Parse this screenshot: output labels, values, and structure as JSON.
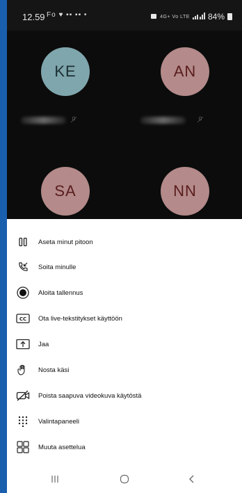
{
  "status_bar": {
    "time": "12.59",
    "left_icons": "Fo ♥ ▪▪ ▪▪ •",
    "network": "4G+ Vo LTE",
    "battery": "84%"
  },
  "participants": [
    {
      "initials": "KE",
      "bg": "#7fa6ad",
      "fg": "#1b2f33"
    },
    {
      "initials": "AN",
      "bg": "#b48a8a",
      "fg": "#5a1d1d"
    },
    {
      "initials": "SA",
      "bg": "#b48a8a",
      "fg": "#5a1d1d"
    },
    {
      "initials": "NN",
      "bg": "#b48a8a",
      "fg": "#5a1d1d"
    }
  ],
  "menu": {
    "hold": "Aseta minut pitoon",
    "call_me": "Soita minulle",
    "record": "Aloita tallennus",
    "captions": "Ota live-tekstitykset käyttöön",
    "share": "Jaa",
    "raise_hand": "Nosta käsi",
    "video_off": "Poista saapuva videokuva käytöstä",
    "dialpad": "Valintapaneeli",
    "layout": "Muuta asettelua"
  }
}
